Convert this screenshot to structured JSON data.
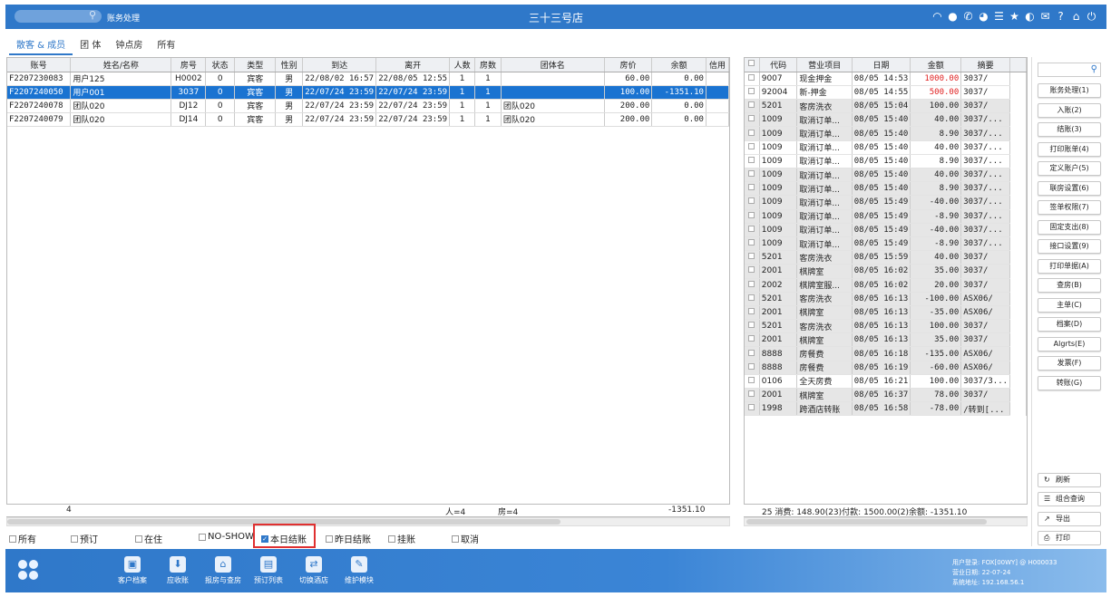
{
  "header": {
    "breadcrumb": "账务处理",
    "title": "三十三号店",
    "icons": [
      "wifi-icon",
      "chat-icon",
      "phone-icon",
      "palette-icon",
      "menu-icon",
      "star-icon",
      "theme-icon",
      "mail-icon",
      "help-icon",
      "home-icon",
      "power-icon"
    ]
  },
  "tabs": [
    {
      "label": "散客 & 成员",
      "active": true
    },
    {
      "label": "团 体",
      "active": false
    },
    {
      "label": "钟点房",
      "active": false
    },
    {
      "label": "所有",
      "active": false
    }
  ],
  "guest_table": {
    "columns": [
      "账号",
      "姓名/名称",
      "房号",
      "状态",
      "类型",
      "性别",
      "到达",
      "离开",
      "人数",
      "房数",
      "团体名",
      "房价",
      "余额",
      "信用"
    ],
    "rows": [
      [
        "F2207230083",
        "用户125",
        "H0002",
        "0",
        "宾客",
        "男",
        "22/08/02 16:57",
        "22/08/05 12:55",
        "1",
        "1",
        "",
        "60.00",
        "0.00"
      ],
      [
        "F2207240050",
        "用户001",
        "3037",
        "0",
        "宾客",
        "男",
        "22/07/24 23:59",
        "22/07/24 23:59",
        "1",
        "1",
        "",
        "100.00",
        "-1351.10"
      ],
      [
        "F2207240078",
        "团队020",
        "DJ12",
        "0",
        "宾客",
        "男",
        "22/07/24 23:59",
        "22/07/24 23:59",
        "1",
        "1",
        "团队020",
        "200.00",
        "0.00"
      ],
      [
        "F2207240079",
        "团队020",
        "DJ14",
        "0",
        "宾客",
        "男",
        "22/07/24 23:59",
        "22/07/24 23:59",
        "1",
        "1",
        "团队020",
        "200.00",
        "0.00"
      ]
    ],
    "selected_row": 1,
    "footer": {
      "count": "4",
      "people": "人=4",
      "rooms": "房=4",
      "balance": "-1351.10"
    }
  },
  "filters": [
    {
      "label": "所有",
      "checked": false
    },
    {
      "label": "预订",
      "checked": false
    },
    {
      "label": "在住",
      "checked": false
    },
    {
      "label": "NO-SHOW",
      "checked": false
    },
    {
      "label": "本日结账",
      "checked": true
    },
    {
      "label": "昨日结账",
      "checked": false
    },
    {
      "label": "挂账",
      "checked": false
    },
    {
      "label": "取消",
      "checked": false
    }
  ],
  "account_table": {
    "columns": [
      "代码",
      "营业项目",
      "日期",
      "金额",
      "摘要"
    ],
    "rows": [
      [
        "9007",
        "现金押金",
        "08/05 14:53",
        "1000.00",
        "3037/",
        false,
        true
      ],
      [
        "92004",
        "新-押金",
        "08/05 14:55",
        "500.00",
        "3037/",
        false,
        true
      ],
      [
        "5201",
        "客房洗衣",
        "08/05 15:04",
        "100.00",
        "3037/",
        true,
        false
      ],
      [
        "1009",
        "取消订单...",
        "08/05 15:40",
        "40.00",
        "3037/...",
        true,
        false
      ],
      [
        "1009",
        "取消订单...",
        "08/05 15:40",
        "8.90",
        "3037/...",
        true,
        false
      ],
      [
        "1009",
        "取消订单...",
        "08/05 15:40",
        "40.00",
        "3037/...",
        false,
        false
      ],
      [
        "1009",
        "取消订单...",
        "08/05 15:40",
        "8.90",
        "3037/...",
        false,
        false
      ],
      [
        "1009",
        "取消订单...",
        "08/05 15:40",
        "40.00",
        "3037/...",
        true,
        false
      ],
      [
        "1009",
        "取消订单...",
        "08/05 15:40",
        "8.90",
        "3037/...",
        true,
        false
      ],
      [
        "1009",
        "取消订单...",
        "08/05 15:49",
        "-40.00",
        "3037/...",
        true,
        false
      ],
      [
        "1009",
        "取消订单...",
        "08/05 15:49",
        "-8.90",
        "3037/...",
        true,
        false
      ],
      [
        "1009",
        "取消订单...",
        "08/05 15:49",
        "-40.00",
        "3037/...",
        true,
        false
      ],
      [
        "1009",
        "取消订单...",
        "08/05 15:49",
        "-8.90",
        "3037/...",
        true,
        false
      ],
      [
        "5201",
        "客房洗衣",
        "08/05 15:59",
        "40.00",
        "3037/",
        true,
        false
      ],
      [
        "2001",
        "棋牌室",
        "08/05 16:02",
        "35.00",
        "3037/",
        true,
        false
      ],
      [
        "2002",
        "棋牌室服...",
        "08/05 16:02",
        "20.00",
        "3037/",
        true,
        false
      ],
      [
        "5201",
        "客房洗衣",
        "08/05 16:13",
        "-100.00",
        "ASX06/",
        true,
        false
      ],
      [
        "2001",
        "棋牌室",
        "08/05 16:13",
        "-35.00",
        "ASX06/",
        true,
        false
      ],
      [
        "5201",
        "客房洗衣",
        "08/05 16:13",
        "100.00",
        "3037/",
        true,
        false
      ],
      [
        "2001",
        "棋牌室",
        "08/05 16:13",
        "35.00",
        "3037/",
        true,
        false
      ],
      [
        "8888",
        "房餐费",
        "08/05 16:18",
        "-135.00",
        "ASX06/",
        true,
        false
      ],
      [
        "8888",
        "房餐费",
        "08/05 16:19",
        "-60.00",
        "ASX06/",
        true,
        false
      ],
      [
        "0106",
        "全天房费",
        "08/05 16:21",
        "100.00",
        "3037/3...",
        false,
        false
      ],
      [
        "2001",
        "棋牌室",
        "08/05 16:37",
        "78.00",
        "3037/",
        true,
        false
      ],
      [
        "1998",
        "跨酒店转账",
        "08/05 16:58",
        "-78.00",
        "/转到[...",
        true,
        false
      ]
    ],
    "footer": "25 消费: 148.90(23)付款: 1500.00(2)余额: -1351.10"
  },
  "side_buttons": [
    "账务处理(1)",
    "入账(2)",
    "结账(3)",
    "打印账单(4)",
    "定义账户(5)",
    "联房设置(6)",
    "签单权限(7)",
    "固定支出(8)",
    "接口设置(9)",
    "打印单据(A)",
    "查房(B)",
    "主单(C)",
    "档案(D)",
    "Algrts(E)",
    "发票(F)",
    "转账(G)"
  ],
  "side_actions": [
    {
      "label": "刷新",
      "icon": "refresh-icon",
      "glyph": "↻"
    },
    {
      "label": "组合查询",
      "icon": "list-icon",
      "glyph": "☰"
    },
    {
      "label": "导出",
      "icon": "export-icon",
      "glyph": "↗"
    },
    {
      "label": "打印",
      "icon": "printer-icon",
      "glyph": "⎙"
    }
  ],
  "bottom_nav": [
    {
      "label": "客户档案",
      "icon": "customer-icon",
      "glyph": "▣"
    },
    {
      "label": "应收账",
      "icon": "receivable-icon",
      "glyph": "⬇"
    },
    {
      "label": "报房与查房",
      "icon": "room-icon",
      "glyph": "⌂"
    },
    {
      "label": "预订列表",
      "icon": "booking-icon",
      "glyph": "▤"
    },
    {
      "label": "切换酒店",
      "icon": "switch-icon",
      "glyph": "⇄"
    },
    {
      "label": "维护模块",
      "icon": "wrench-icon",
      "glyph": "✎"
    }
  ],
  "status": {
    "user": "用户登录: FOX[00WY] @ H000033",
    "business_date": "营业日期: 22-07-24",
    "system_address": "系统地址: 192.168.56.1"
  }
}
